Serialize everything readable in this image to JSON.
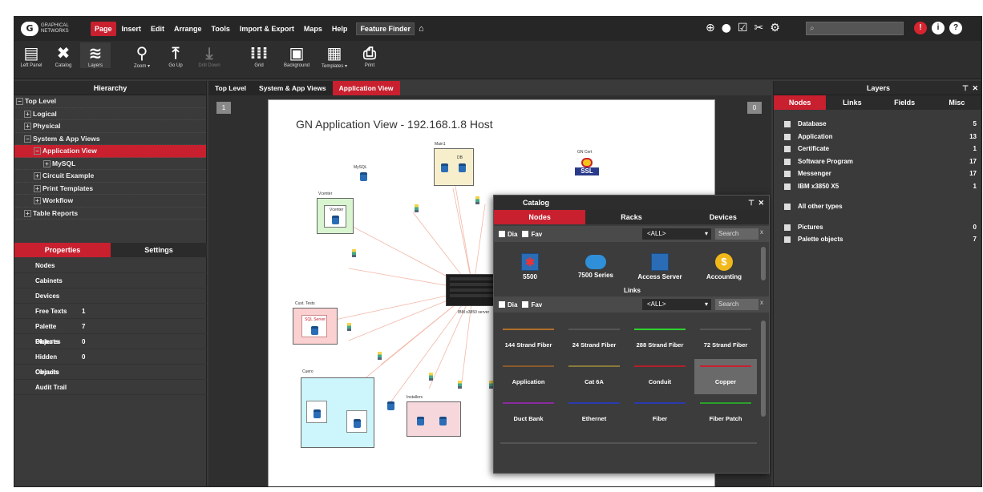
{
  "app": {
    "logo_glyph": "G",
    "logo_text": "Graphical Networks"
  },
  "menubar": {
    "items": [
      "Page",
      "Insert",
      "Edit",
      "Arrange",
      "Tools",
      "Import & Export",
      "Maps",
      "Help"
    ],
    "active_index": 0,
    "feature_finder": "Feature Finder",
    "home_icon": "home-icon",
    "search_placeholder": "⌕",
    "right_icons": [
      "globe-icon",
      "circle-icon",
      "check-square-icon",
      "tools-icon",
      "gear-icon"
    ],
    "alert_icons": [
      "!",
      "i",
      "?"
    ]
  },
  "toolbar": {
    "tools": [
      {
        "label": "Left Panel",
        "icon": "left-panel-icon"
      },
      {
        "label": "Catalog",
        "icon": "catalog-icon"
      },
      {
        "label": "Layers",
        "icon": "layers-icon"
      },
      {
        "label": "Zoom ▾",
        "icon": "zoom-icon"
      },
      {
        "label": "Go Up",
        "icon": "go-up-icon"
      },
      {
        "label": "Drill Down",
        "icon": "drill-down-icon"
      },
      {
        "label": "Grid",
        "icon": "grid-icon"
      },
      {
        "label": "Background",
        "icon": "background-icon"
      },
      {
        "label": "Templates ▾",
        "icon": "templates-icon"
      },
      {
        "label": "Print",
        "icon": "print-icon"
      }
    ]
  },
  "hierarchy": {
    "title": "Hierarchy",
    "items": [
      {
        "label": "Top Level",
        "indent": 0
      },
      {
        "label": "Logical",
        "indent": 1
      },
      {
        "label": "Physical",
        "indent": 1
      },
      {
        "label": "System & App Views",
        "indent": 1
      },
      {
        "label": "Application View",
        "indent": 2,
        "selected": true
      },
      {
        "label": "MySQL",
        "indent": 3
      },
      {
        "label": "Circuit Example",
        "indent": 2
      },
      {
        "label": "Print Templates",
        "indent": 2
      },
      {
        "label": "Workflow",
        "indent": 2
      },
      {
        "label": "Table Reports",
        "indent": 1
      }
    ]
  },
  "properties": {
    "tabs": [
      "Properties",
      "Settings"
    ],
    "rows": [
      {
        "key": "Nodes",
        "value": "",
        "red": true
      },
      {
        "key": "Cabinets",
        "value": "",
        "red": true
      },
      {
        "key": "Devices",
        "value": "",
        "red": true
      },
      {
        "key": "Free Texts",
        "value": "1",
        "red": false
      },
      {
        "key": "Palette Objects",
        "value": "7",
        "red": false
      },
      {
        "key": "Pictures",
        "value": "0",
        "red": false
      },
      {
        "key": "Hidden Objects",
        "value": "0",
        "red": false
      },
      {
        "key": "Circuits",
        "value": "",
        "red": true
      },
      {
        "key": "Audit Trail",
        "value": "",
        "red": true
      }
    ]
  },
  "breadcrumb": [
    "Top Level",
    "System & App Views",
    "Application View"
  ],
  "canvas": {
    "page_left": "1",
    "page_right": "0",
    "title": "GN Application View - 192.168.1.8 Host",
    "labels": {
      "main1": "Main1",
      "mysql": "MySQL",
      "gncert": "GN Cert",
      "ssl": "SSL",
      "vcenter": "Vcenter",
      "vcenter_inner": "Vcenter",
      "custtests": "Cust. Tests",
      "sqlserver": "SQL Server",
      "cuero": "Cuero",
      "installers": "Installers",
      "ibmserver": "IBM x3850 server",
      "db": "DB"
    }
  },
  "catalog": {
    "title": "Catalog",
    "tabs": [
      "Nodes",
      "Racks",
      "Devices"
    ],
    "filter_dia": "Dia",
    "filter_fav": "Fav",
    "select_value": "<ALL>",
    "search_label": "Search",
    "clear_label": "x",
    "nodes": [
      {
        "label": "5500",
        "icon": "router-star-icon"
      },
      {
        "label": "7500 Series",
        "icon": "router-icon"
      },
      {
        "label": "Access Server",
        "icon": "access-server-icon"
      },
      {
        "label": "Accounting",
        "icon": "dollar-icon"
      }
    ],
    "links_title": "Links",
    "links": [
      {
        "label": "144 Strand Fiber",
        "color": "#b0702a"
      },
      {
        "label": "24 Strand Fiber",
        "color": "#555555"
      },
      {
        "label": "288 Strand Fiber",
        "color": "#2fd12f"
      },
      {
        "label": "72 Strand Fiber",
        "color": "#555555"
      },
      {
        "label": "Application",
        "color": "#8a5a2a"
      },
      {
        "label": "Cat 6A",
        "color": "#8a7a3a"
      },
      {
        "label": "Conduit",
        "color": "#b0202a"
      },
      {
        "label": "Copper",
        "color": "#c8202f",
        "selected": true
      },
      {
        "label": "Duct Bank",
        "color": "#8a2aa0"
      },
      {
        "label": "Ethernet",
        "color": "#2a3ab0"
      },
      {
        "label": "Fiber",
        "color": "#2a3ab0"
      },
      {
        "label": "Fiber Patch",
        "color": "#2aa02a"
      }
    ]
  },
  "layers": {
    "title": "Layers",
    "tabs": [
      "Nodes",
      "Links",
      "Fields",
      "Misc"
    ],
    "rows": [
      {
        "label": "Database",
        "count": "5"
      },
      {
        "label": "Application",
        "count": "13"
      },
      {
        "label": "Certificate",
        "count": "1"
      },
      {
        "label": "Software Program",
        "count": "17"
      },
      {
        "label": "Messenger",
        "count": "17"
      },
      {
        "label": "IBM x3850 X5",
        "count": "1"
      }
    ],
    "other_types": "All other types",
    "extra_rows": [
      {
        "label": "Pictures",
        "count": "0"
      },
      {
        "label": "Palette objects",
        "count": "7"
      }
    ]
  },
  "colors": {
    "accent": "#c8202f",
    "panel": "#3a3a3a",
    "dark": "#262626"
  }
}
